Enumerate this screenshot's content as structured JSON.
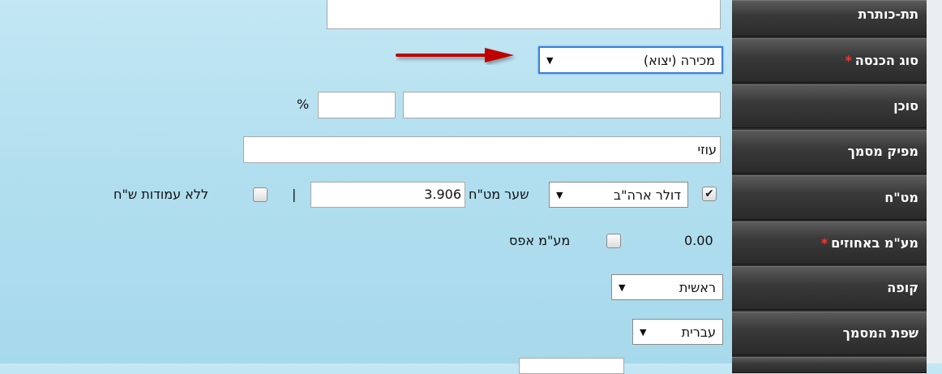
{
  "labels": {
    "subtitle": "תת-כותרת",
    "income_type": "סוג הכנסה",
    "agent": "סוכן",
    "doc_issuer": "מפיק מסמך",
    "currency": "מט\"ח",
    "vat_percent": "מע\"מ באחוזים",
    "cash_register": "קופה",
    "doc_language": "שפת המסמך"
  },
  "required_marker": "*",
  "fields": {
    "income_type_value": "מכירה (יצוא)",
    "agent_name": "",
    "agent_percent": "",
    "percent_sign": "%",
    "doc_issuer_value": "עוזי",
    "currency_value": "דולר ארה\"ב",
    "exchange_rate_label": "שער מט\"ח",
    "exchange_rate_value": "3.906",
    "separator": "|",
    "no_shekel_columns_label": "ללא עמודות ש\"ח",
    "vat_value": "0.00",
    "zero_vat_label": "מע\"מ אפס",
    "cash_register_value": "ראשית",
    "doc_language_value": "עברית"
  },
  "icons": {
    "dropdown_arrow": "▼",
    "check": "✔"
  },
  "colors": {
    "arrow": "#c00000",
    "required": "#ff3333",
    "focus": "#3c7fd6",
    "label_bg": "#2f2f2f",
    "page_bg": "#b2dfef"
  },
  "state": {
    "currency_checked": true,
    "no_shekel_columns_checked": false,
    "zero_vat_checked": false
  }
}
